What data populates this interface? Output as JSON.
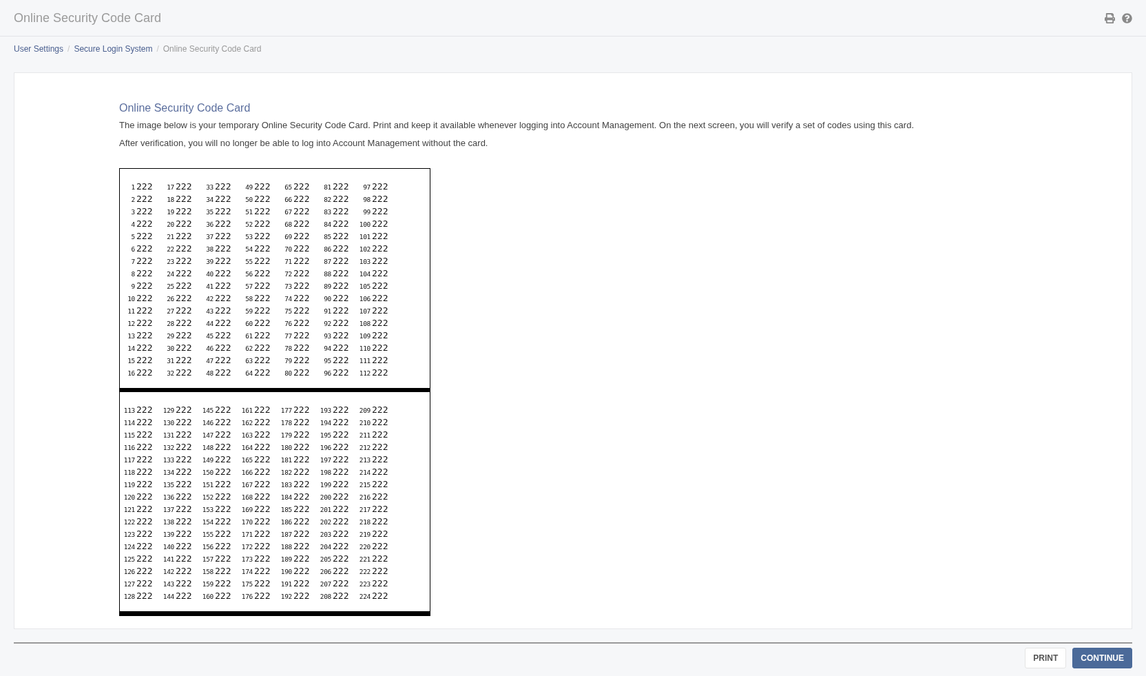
{
  "header": {
    "title": "Online Security Code Card"
  },
  "breadcrumb_separator": "/",
  "breadcrumb": [
    {
      "label": "User Settings",
      "current": false
    },
    {
      "label": "Secure Login System",
      "current": false
    },
    {
      "label": "Online Security Code Card",
      "current": true
    }
  ],
  "content": {
    "title": "Online Security Code Card",
    "paragraphs": [
      "The image below is your temporary Online Security Code Card. Print and keep it available whenever logging into Account Management. On the next screen, you will verify a set of codes using this card.",
      "After verification, you will no longer be able to log into Account Management without the card."
    ]
  },
  "code_card": {
    "sections": [
      {
        "columns": [
          [
            [
              "1",
              "222"
            ],
            [
              "2",
              "222"
            ],
            [
              "3",
              "222"
            ],
            [
              "4",
              "222"
            ],
            [
              "5",
              "222"
            ],
            [
              "6",
              "222"
            ],
            [
              "7",
              "222"
            ],
            [
              "8",
              "222"
            ],
            [
              "9",
              "222"
            ],
            [
              "10",
              "222"
            ],
            [
              "11",
              "222"
            ],
            [
              "12",
              "222"
            ],
            [
              "13",
              "222"
            ],
            [
              "14",
              "222"
            ],
            [
              "15",
              "222"
            ],
            [
              "16",
              "222"
            ]
          ],
          [
            [
              "17",
              "222"
            ],
            [
              "18",
              "222"
            ],
            [
              "19",
              "222"
            ],
            [
              "20",
              "222"
            ],
            [
              "21",
              "222"
            ],
            [
              "22",
              "222"
            ],
            [
              "23",
              "222"
            ],
            [
              "24",
              "222"
            ],
            [
              "25",
              "222"
            ],
            [
              "26",
              "222"
            ],
            [
              "27",
              "222"
            ],
            [
              "28",
              "222"
            ],
            [
              "29",
              "222"
            ],
            [
              "30",
              "222"
            ],
            [
              "31",
              "222"
            ],
            [
              "32",
              "222"
            ]
          ],
          [
            [
              "33",
              "222"
            ],
            [
              "34",
              "222"
            ],
            [
              "35",
              "222"
            ],
            [
              "36",
              "222"
            ],
            [
              "37",
              "222"
            ],
            [
              "38",
              "222"
            ],
            [
              "39",
              "222"
            ],
            [
              "40",
              "222"
            ],
            [
              "41",
              "222"
            ],
            [
              "42",
              "222"
            ],
            [
              "43",
              "222"
            ],
            [
              "44",
              "222"
            ],
            [
              "45",
              "222"
            ],
            [
              "46",
              "222"
            ],
            [
              "47",
              "222"
            ],
            [
              "48",
              "222"
            ]
          ],
          [
            [
              "49",
              "222"
            ],
            [
              "50",
              "222"
            ],
            [
              "51",
              "222"
            ],
            [
              "52",
              "222"
            ],
            [
              "53",
              "222"
            ],
            [
              "54",
              "222"
            ],
            [
              "55",
              "222"
            ],
            [
              "56",
              "222"
            ],
            [
              "57",
              "222"
            ],
            [
              "58",
              "222"
            ],
            [
              "59",
              "222"
            ],
            [
              "60",
              "222"
            ],
            [
              "61",
              "222"
            ],
            [
              "62",
              "222"
            ],
            [
              "63",
              "222"
            ],
            [
              "64",
              "222"
            ]
          ],
          [
            [
              "65",
              "222"
            ],
            [
              "66",
              "222"
            ],
            [
              "67",
              "222"
            ],
            [
              "68",
              "222"
            ],
            [
              "69",
              "222"
            ],
            [
              "70",
              "222"
            ],
            [
              "71",
              "222"
            ],
            [
              "72",
              "222"
            ],
            [
              "73",
              "222"
            ],
            [
              "74",
              "222"
            ],
            [
              "75",
              "222"
            ],
            [
              "76",
              "222"
            ],
            [
              "77",
              "222"
            ],
            [
              "78",
              "222"
            ],
            [
              "79",
              "222"
            ],
            [
              "80",
              "222"
            ]
          ],
          [
            [
              "81",
              "222"
            ],
            [
              "82",
              "222"
            ],
            [
              "83",
              "222"
            ],
            [
              "84",
              "222"
            ],
            [
              "85",
              "222"
            ],
            [
              "86",
              "222"
            ],
            [
              "87",
              "222"
            ],
            [
              "88",
              "222"
            ],
            [
              "89",
              "222"
            ],
            [
              "90",
              "222"
            ],
            [
              "91",
              "222"
            ],
            [
              "92",
              "222"
            ],
            [
              "93",
              "222"
            ],
            [
              "94",
              "222"
            ],
            [
              "95",
              "222"
            ],
            [
              "96",
              "222"
            ]
          ],
          [
            [
              "97",
              "222"
            ],
            [
              "98",
              "222"
            ],
            [
              "99",
              "222"
            ],
            [
              "100",
              "222"
            ],
            [
              "101",
              "222"
            ],
            [
              "102",
              "222"
            ],
            [
              "103",
              "222"
            ],
            [
              "104",
              "222"
            ],
            [
              "105",
              "222"
            ],
            [
              "106",
              "222"
            ],
            [
              "107",
              "222"
            ],
            [
              "108",
              "222"
            ],
            [
              "109",
              "222"
            ],
            [
              "110",
              "222"
            ],
            [
              "111",
              "222"
            ],
            [
              "112",
              "222"
            ]
          ]
        ]
      },
      {
        "columns": [
          [
            [
              "113",
              "222"
            ],
            [
              "114",
              "222"
            ],
            [
              "115",
              "222"
            ],
            [
              "116",
              "222"
            ],
            [
              "117",
              "222"
            ],
            [
              "118",
              "222"
            ],
            [
              "119",
              "222"
            ],
            [
              "120",
              "222"
            ],
            [
              "121",
              "222"
            ],
            [
              "122",
              "222"
            ],
            [
              "123",
              "222"
            ],
            [
              "124",
              "222"
            ],
            [
              "125",
              "222"
            ],
            [
              "126",
              "222"
            ],
            [
              "127",
              "222"
            ],
            [
              "128",
              "222"
            ]
          ],
          [
            [
              "129",
              "222"
            ],
            [
              "130",
              "222"
            ],
            [
              "131",
              "222"
            ],
            [
              "132",
              "222"
            ],
            [
              "133",
              "222"
            ],
            [
              "134",
              "222"
            ],
            [
              "135",
              "222"
            ],
            [
              "136",
              "222"
            ],
            [
              "137",
              "222"
            ],
            [
              "138",
              "222"
            ],
            [
              "139",
              "222"
            ],
            [
              "140",
              "222"
            ],
            [
              "141",
              "222"
            ],
            [
              "142",
              "222"
            ],
            [
              "143",
              "222"
            ],
            [
              "144",
              "222"
            ]
          ],
          [
            [
              "145",
              "222"
            ],
            [
              "146",
              "222"
            ],
            [
              "147",
              "222"
            ],
            [
              "148",
              "222"
            ],
            [
              "149",
              "222"
            ],
            [
              "150",
              "222"
            ],
            [
              "151",
              "222"
            ],
            [
              "152",
              "222"
            ],
            [
              "153",
              "222"
            ],
            [
              "154",
              "222"
            ],
            [
              "155",
              "222"
            ],
            [
              "156",
              "222"
            ],
            [
              "157",
              "222"
            ],
            [
              "158",
              "222"
            ],
            [
              "159",
              "222"
            ],
            [
              "160",
              "222"
            ]
          ],
          [
            [
              "161",
              "222"
            ],
            [
              "162",
              "222"
            ],
            [
              "163",
              "222"
            ],
            [
              "164",
              "222"
            ],
            [
              "165",
              "222"
            ],
            [
              "166",
              "222"
            ],
            [
              "167",
              "222"
            ],
            [
              "168",
              "222"
            ],
            [
              "169",
              "222"
            ],
            [
              "170",
              "222"
            ],
            [
              "171",
              "222"
            ],
            [
              "172",
              "222"
            ],
            [
              "173",
              "222"
            ],
            [
              "174",
              "222"
            ],
            [
              "175",
              "222"
            ],
            [
              "176",
              "222"
            ]
          ],
          [
            [
              "177",
              "222"
            ],
            [
              "178",
              "222"
            ],
            [
              "179",
              "222"
            ],
            [
              "180",
              "222"
            ],
            [
              "181",
              "222"
            ],
            [
              "182",
              "222"
            ],
            [
              "183",
              "222"
            ],
            [
              "184",
              "222"
            ],
            [
              "185",
              "222"
            ],
            [
              "186",
              "222"
            ],
            [
              "187",
              "222"
            ],
            [
              "188",
              "222"
            ],
            [
              "189",
              "222"
            ],
            [
              "190",
              "222"
            ],
            [
              "191",
              "222"
            ],
            [
              "192",
              "222"
            ]
          ],
          [
            [
              "193",
              "222"
            ],
            [
              "194",
              "222"
            ],
            [
              "195",
              "222"
            ],
            [
              "196",
              "222"
            ],
            [
              "197",
              "222"
            ],
            [
              "198",
              "222"
            ],
            [
              "199",
              "222"
            ],
            [
              "200",
              "222"
            ],
            [
              "201",
              "222"
            ],
            [
              "202",
              "222"
            ],
            [
              "203",
              "222"
            ],
            [
              "204",
              "222"
            ],
            [
              "205",
              "222"
            ],
            [
              "206",
              "222"
            ],
            [
              "207",
              "222"
            ],
            [
              "208",
              "222"
            ]
          ],
          [
            [
              "209",
              "222"
            ],
            [
              "210",
              "222"
            ],
            [
              "211",
              "222"
            ],
            [
              "212",
              "222"
            ],
            [
              "213",
              "222"
            ],
            [
              "214",
              "222"
            ],
            [
              "215",
              "222"
            ],
            [
              "216",
              "222"
            ],
            [
              "217",
              "222"
            ],
            [
              "218",
              "222"
            ],
            [
              "219",
              "222"
            ],
            [
              "220",
              "222"
            ],
            [
              "221",
              "222"
            ],
            [
              "222",
              "222"
            ],
            [
              "223",
              "222"
            ],
            [
              "224",
              "222"
            ]
          ]
        ]
      }
    ]
  },
  "footer": {
    "buttons": [
      {
        "label": "PRINT",
        "kind": "secondary"
      },
      {
        "label": "CONTINUE",
        "kind": "primary"
      }
    ]
  }
}
